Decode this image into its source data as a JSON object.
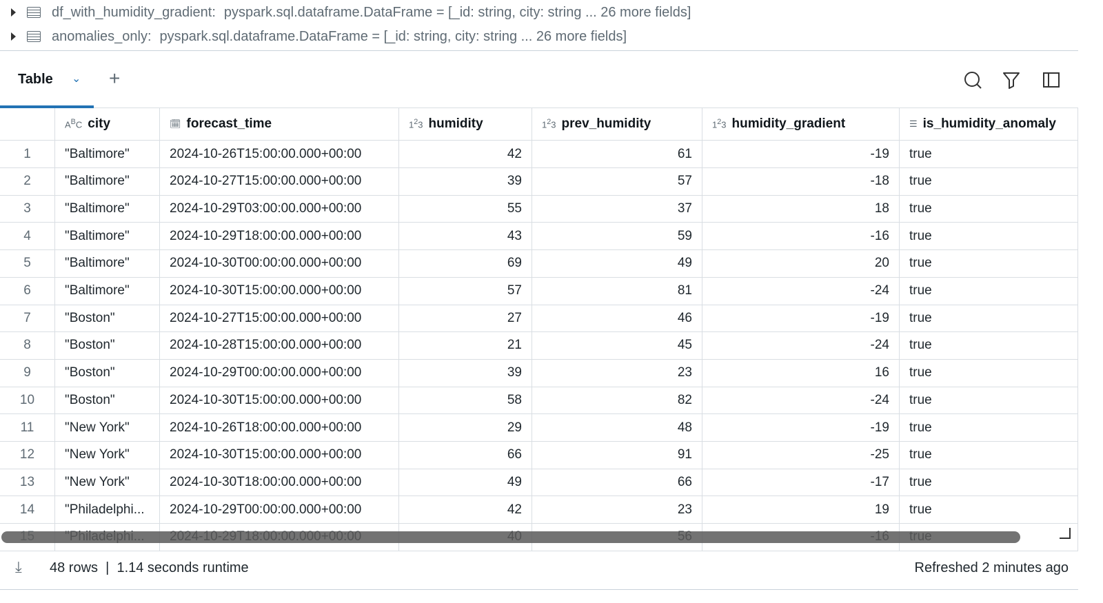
{
  "dataframes": [
    {
      "name": "df_with_humidity_gradient:",
      "type": "pyspark.sql.dataframe.DataFrame = [_id: string, city: string ... 26 more fields]"
    },
    {
      "name": "anomalies_only:",
      "type": "pyspark.sql.dataframe.DataFrame = [_id: string, city: string ... 26 more fields]"
    }
  ],
  "tabs": {
    "active": "Table"
  },
  "columns": [
    {
      "name": "city",
      "icon": "ABC"
    },
    {
      "name": "forecast_time",
      "icon": "calendar-clock"
    },
    {
      "name": "humidity",
      "icon": "123"
    },
    {
      "name": "prev_humidity",
      "icon": "123"
    },
    {
      "name": "humidity_gradient",
      "icon": "123"
    },
    {
      "name": "is_humidity_anomaly",
      "icon": "checklist"
    }
  ],
  "rows": [
    [
      "1",
      "\"Baltimore\"",
      "2024-10-26T15:00:00.000+00:00",
      "42",
      "61",
      "-19",
      "true"
    ],
    [
      "2",
      "\"Baltimore\"",
      "2024-10-27T15:00:00.000+00:00",
      "39",
      "57",
      "-18",
      "true"
    ],
    [
      "3",
      "\"Baltimore\"",
      "2024-10-29T03:00:00.000+00:00",
      "55",
      "37",
      "18",
      "true"
    ],
    [
      "4",
      "\"Baltimore\"",
      "2024-10-29T18:00:00.000+00:00",
      "43",
      "59",
      "-16",
      "true"
    ],
    [
      "5",
      "\"Baltimore\"",
      "2024-10-30T00:00:00.000+00:00",
      "69",
      "49",
      "20",
      "true"
    ],
    [
      "6",
      "\"Baltimore\"",
      "2024-10-30T15:00:00.000+00:00",
      "57",
      "81",
      "-24",
      "true"
    ],
    [
      "7",
      "\"Boston\"",
      "2024-10-27T15:00:00.000+00:00",
      "27",
      "46",
      "-19",
      "true"
    ],
    [
      "8",
      "\"Boston\"",
      "2024-10-28T15:00:00.000+00:00",
      "21",
      "45",
      "-24",
      "true"
    ],
    [
      "9",
      "\"Boston\"",
      "2024-10-29T00:00:00.000+00:00",
      "39",
      "23",
      "16",
      "true"
    ],
    [
      "10",
      "\"Boston\"",
      "2024-10-30T15:00:00.000+00:00",
      "58",
      "82",
      "-24",
      "true"
    ],
    [
      "11",
      "\"New York\"",
      "2024-10-26T18:00:00.000+00:00",
      "29",
      "48",
      "-19",
      "true"
    ],
    [
      "12",
      "\"New York\"",
      "2024-10-30T15:00:00.000+00:00",
      "66",
      "91",
      "-25",
      "true"
    ],
    [
      "13",
      "\"New York\"",
      "2024-10-30T18:00:00.000+00:00",
      "49",
      "66",
      "-17",
      "true"
    ],
    [
      "14",
      "\"Philadelphi...",
      "2024-10-29T00:00:00.000+00:00",
      "42",
      "23",
      "19",
      "true"
    ],
    [
      "15",
      "\"Philadelphi...",
      "2024-10-29T18:00:00.000+00:00",
      "40",
      "56",
      "-16",
      "true"
    ]
  ],
  "footer": {
    "stats": "48 rows  |  1.14 seconds runtime",
    "refreshed": "Refreshed 2 minutes ago"
  }
}
